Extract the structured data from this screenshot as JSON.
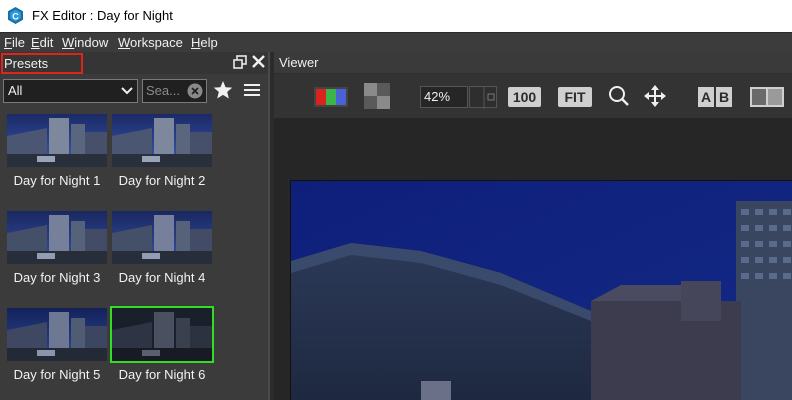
{
  "window": {
    "title": "FX Editor : Day for Night"
  },
  "menu": [
    {
      "label": "File",
      "mnemonic": "F",
      "rest": "ile"
    },
    {
      "label": "Edit",
      "mnemonic": "E",
      "rest": "dit"
    },
    {
      "label": "Window",
      "mnemonic": "W",
      "rest": "indow"
    },
    {
      "label": "Workspace",
      "mnemonic": "W",
      "rest": "orkspace"
    },
    {
      "label": "Help",
      "mnemonic": "H",
      "rest": "elp"
    }
  ],
  "presets": {
    "title": "Presets",
    "filter_value": "All",
    "search_placeholder": "Sea...",
    "items": [
      {
        "label": "Day for Night 1",
        "selected": false
      },
      {
        "label": "Day for Night 2",
        "selected": false
      },
      {
        "label": "Day for Night 3",
        "selected": false
      },
      {
        "label": "Day for Night 4",
        "selected": false
      },
      {
        "label": "Day for Night 5",
        "selected": false
      },
      {
        "label": "Day for Night 6",
        "selected": true
      }
    ]
  },
  "viewer": {
    "title": "Viewer",
    "zoom": "42%",
    "btn_100": "100",
    "btn_fit": "FIT",
    "btn_a": "A",
    "btn_b": "B"
  },
  "colors": {
    "highlight_red": "#e0231b",
    "selected_green": "#33dd22",
    "panel_bg": "#3b3b3b"
  }
}
